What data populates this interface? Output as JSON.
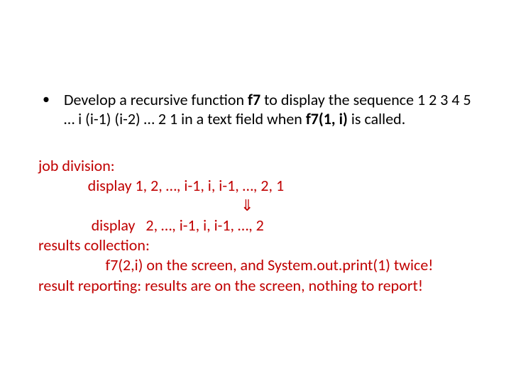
{
  "bullet": {
    "seg1": "Develop a recursive function ",
    "fn": "f7",
    "seg2": "  to display the sequence 1 2 3 4 5 … i   (i-1)  (i-2) … 2 1 in a text field when ",
    "call": "f7(1, i)",
    "seg3": " is called."
  },
  "red": {
    "l1": "job division:",
    "l2": "              display 1, 2, …, i-1, i, i-1, …, 2, 1",
    "arrow": "⇓",
    "l3": "               display   2, …, i-1, i, i-1, …, 2",
    "l4": "results collection:",
    "l5": "                   f7(2,i) on the screen, and System.out.print(1) twice!",
    "l6": "result reporting: results are on the screen, nothing to report!"
  }
}
